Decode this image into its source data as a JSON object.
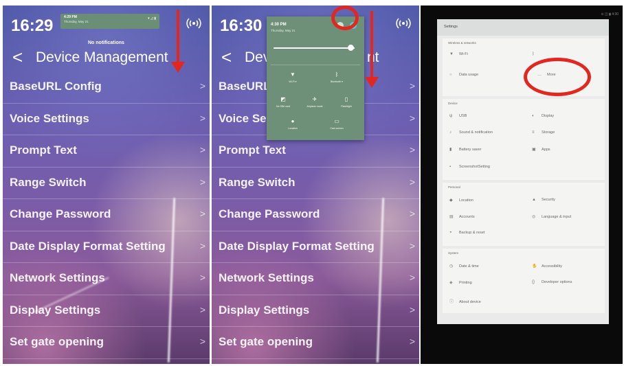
{
  "panel1": {
    "clock": "16:29",
    "notification": {
      "time": "4:29 PM",
      "date": "Thursday, May 21",
      "status_icons": "▾ ◿ ▮"
    },
    "no_notifications": "No notifications",
    "back_glyph": "<",
    "title": "Device Management",
    "menu": [
      {
        "label": "BaseURL Config"
      },
      {
        "label": "Voice Settings"
      },
      {
        "label": "Prompt Text"
      },
      {
        "label": "Range Switch"
      },
      {
        "label": "Change Password"
      },
      {
        "label": "Date Display Format Setting"
      },
      {
        "label": "Network Settings"
      },
      {
        "label": "Display Settings"
      },
      {
        "label": "Set gate opening"
      }
    ],
    "chevron": ">"
  },
  "panel2": {
    "clock": "16:30",
    "title_partial": "Dev",
    "title_tail": "nt",
    "quick_settings": {
      "time": "4:30 PM",
      "date": "Thursday, May 21",
      "tiles": [
        {
          "icon": "wifi-icon",
          "glyph": "▼",
          "label": "Wi-Fi ▾"
        },
        {
          "icon": "bluetooth-icon",
          "glyph": "ᛒ",
          "label": "Bluetooth ▾"
        },
        {
          "icon": "sim-icon",
          "glyph": "◩",
          "label": "No SIM card"
        },
        {
          "icon": "airplane-icon",
          "glyph": "✈",
          "label": "Airplane mode"
        },
        {
          "icon": "flashlight-icon",
          "glyph": "▯",
          "label": "Flashlight"
        },
        {
          "icon": "location-icon",
          "glyph": "●",
          "label": "Location"
        },
        {
          "icon": "cast-icon",
          "glyph": "▭",
          "label": "Cast screen"
        }
      ]
    },
    "menu": [
      {
        "label": "BaseURL"
      },
      {
        "label": "Voice Se"
      },
      {
        "label": "Prompt Text"
      },
      {
        "label": "Range Switch"
      },
      {
        "label": "Change Password"
      },
      {
        "label": "Date Display Format Setting"
      },
      {
        "label": "Network Settings"
      },
      {
        "label": "Display Settings"
      },
      {
        "label": "Set gate opening"
      }
    ],
    "chevron": ">"
  },
  "panel3": {
    "app_title": "Settings",
    "status_icons": "⊙ ◫ ▮ 4:30",
    "sections": [
      {
        "category": "Wireless & networks",
        "items": [
          {
            "icon": "▼",
            "label": "Wi-Fi"
          },
          {
            "icon": "ᛒ",
            "label": ""
          },
          {
            "icon": "○",
            "label": "Data usage"
          },
          {
            "icon": "…",
            "label": "More"
          }
        ]
      },
      {
        "category": "Device",
        "items": [
          {
            "icon": "ψ",
            "label": "USB"
          },
          {
            "icon": "◐",
            "label": "Display"
          },
          {
            "icon": "♪",
            "label": "Sound & notification"
          },
          {
            "icon": "≡",
            "label": "Storage"
          },
          {
            "icon": "▮",
            "label": "Battery saver"
          },
          {
            "icon": "▣",
            "label": "Apps"
          },
          {
            "icon": "▪",
            "label": "ScreenshotSetting"
          }
        ]
      },
      {
        "category": "Personal",
        "items": [
          {
            "icon": "◆",
            "label": "Location"
          },
          {
            "icon": "▲",
            "label": "Security"
          },
          {
            "icon": "▤",
            "label": "Accounts"
          },
          {
            "icon": "◎",
            "label": "Language & input"
          },
          {
            "icon": "◓",
            "label": "Backup & reset"
          }
        ]
      },
      {
        "category": "System",
        "items": [
          {
            "icon": "◷",
            "label": "Date & time"
          },
          {
            "icon": "✋",
            "label": "Accessibility"
          },
          {
            "icon": "◈",
            "label": "Printing"
          },
          {
            "icon": "{}",
            "label": "Developer options"
          },
          {
            "icon": "ⓘ",
            "label": "About device"
          }
        ]
      }
    ]
  },
  "colors": {
    "annotation": "#e3271f",
    "quick_settings": "#6e8f78",
    "settings_bg": "#e9eae9"
  }
}
